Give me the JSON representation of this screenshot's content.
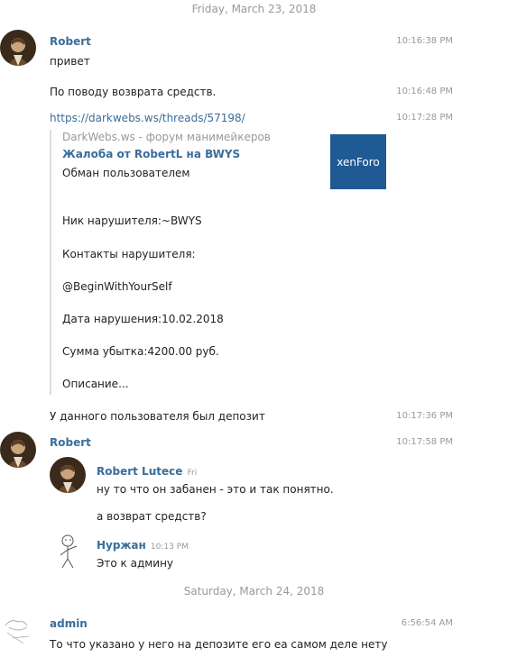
{
  "dates": {
    "first": "Friday, March 23, 2018",
    "second": "Saturday, March 24, 2018"
  },
  "messages": {
    "m1": {
      "author": "Robert",
      "time": "10:16:38 PM",
      "text": "привет"
    },
    "m2": {
      "time": "10:16:48 PM",
      "text": "По поводу возврата средств."
    },
    "m3": {
      "time": "10:17:28 PM",
      "link": "https://darkwebs.ws/threads/57198/",
      "preview": {
        "site": "DarkWebs.ws - форум манимейкеров",
        "title": "Жалоба от RobertL на BWYS",
        "logo_text": "xenForo",
        "lines": [
          "Обман пользователем",
          "Ник нарушителя:~BWYS",
          "Контакты нарушителя:",
          "@BeginWithYourSelf",
          "Дата нарушения:10.02.2018",
          "Сумма убытка:4200.00 руб.",
          "Описание..."
        ]
      }
    },
    "m4": {
      "time": "10:17:36 PM",
      "text": "У данного пользователя был депозит"
    },
    "m5": {
      "author": "Robert",
      "time": "10:17:58 PM",
      "fwd1": {
        "author": "Robert Lutece",
        "day": "Fri",
        "lines": [
          "ну то что он забанен - это и так понятно.",
          "а возврат средств?"
        ]
      },
      "fwd2": {
        "author": "Нуржан",
        "time": "10:13 PM",
        "text": "Это к админу"
      }
    },
    "m6": {
      "author": "admin",
      "time": "6:56:54 AM",
      "text": "То что указано у него на депозите его еа самом деле нету"
    }
  },
  "colors": {
    "accent": "#3a6d99",
    "xenforo": "#1f5a95",
    "meta": "#999999"
  }
}
